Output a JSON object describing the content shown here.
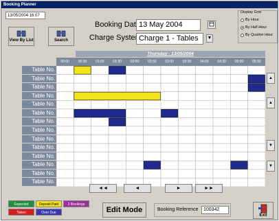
{
  "window": {
    "title": "Booking Planner"
  },
  "datetime": "13/05/2004 16:07",
  "toolbar": {
    "view_by_list": "View By List",
    "search": "Search"
  },
  "booking_date": {
    "label": "Booking Date",
    "value": "13 May 2004"
  },
  "charge_system": {
    "label": "Charge System",
    "value": "Charge 1 - Tables"
  },
  "display_grid": {
    "title": "Display Grid",
    "options": [
      "By Hour",
      "By Half Hour",
      "By Quarter Hour"
    ],
    "selected": "By Half Hour"
  },
  "day_header": "Thursday - 13/05/2004",
  "times": [
    "00:00",
    "00:30",
    "01:00",
    "01:30",
    "02:00",
    "02:30",
    "03:00",
    "03:30",
    "04:00",
    "04:30",
    "05:00",
    "05:30"
  ],
  "rows": [
    "Table No.",
    "Table No.",
    "Table No.",
    "Table No.",
    "Table No.",
    "Table No.",
    "Table No.",
    "Table No.",
    "Table No.",
    "Table No.",
    "Table No.",
    "Table No.",
    "Table No.",
    "Table No."
  ],
  "bookings": [
    {
      "row": 0,
      "start": 1,
      "span": 1,
      "status": "deposit_paid"
    },
    {
      "row": 0,
      "start": 3,
      "span": 1,
      "status": "taken"
    },
    {
      "row": 1,
      "start": 11,
      "span": 1,
      "status": "taken"
    },
    {
      "row": 2,
      "start": 11,
      "span": 1,
      "status": "taken"
    },
    {
      "row": 3,
      "start": 1,
      "span": 5,
      "status": "deposit_paid"
    },
    {
      "row": 5,
      "start": 1,
      "span": 3,
      "status": "taken"
    },
    {
      "row": 5,
      "start": 6,
      "span": 1,
      "status": "taken"
    },
    {
      "row": 6,
      "start": 3,
      "span": 1,
      "status": "taken"
    },
    {
      "row": 11,
      "start": 5,
      "span": 1,
      "status": "taken"
    },
    {
      "row": 11,
      "start": 10,
      "span": 1,
      "status": "taken"
    }
  ],
  "colors": {
    "taken": "#1f2a8f",
    "deposit_paid": "#f2e31a",
    "expected": "#1f8f3a",
    "cancelled": "#d61f1f",
    "two_bookings": "#9a2f9a",
    "over_due": "#3a3ab0"
  },
  "nav": {
    "first": "◄◄",
    "prev": "◄",
    "next": "►",
    "last": "►►"
  },
  "legend": {
    "expected": "Expected",
    "deposit_paid": "Deposit Paid",
    "two_bookings": "2 Bookings",
    "taken": "Taken",
    "over_due": "Over Due"
  },
  "edit_mode": "Edit Mode",
  "booking_reference": {
    "label": "Booking Reference",
    "value": "100342"
  },
  "exit": "Exit"
}
